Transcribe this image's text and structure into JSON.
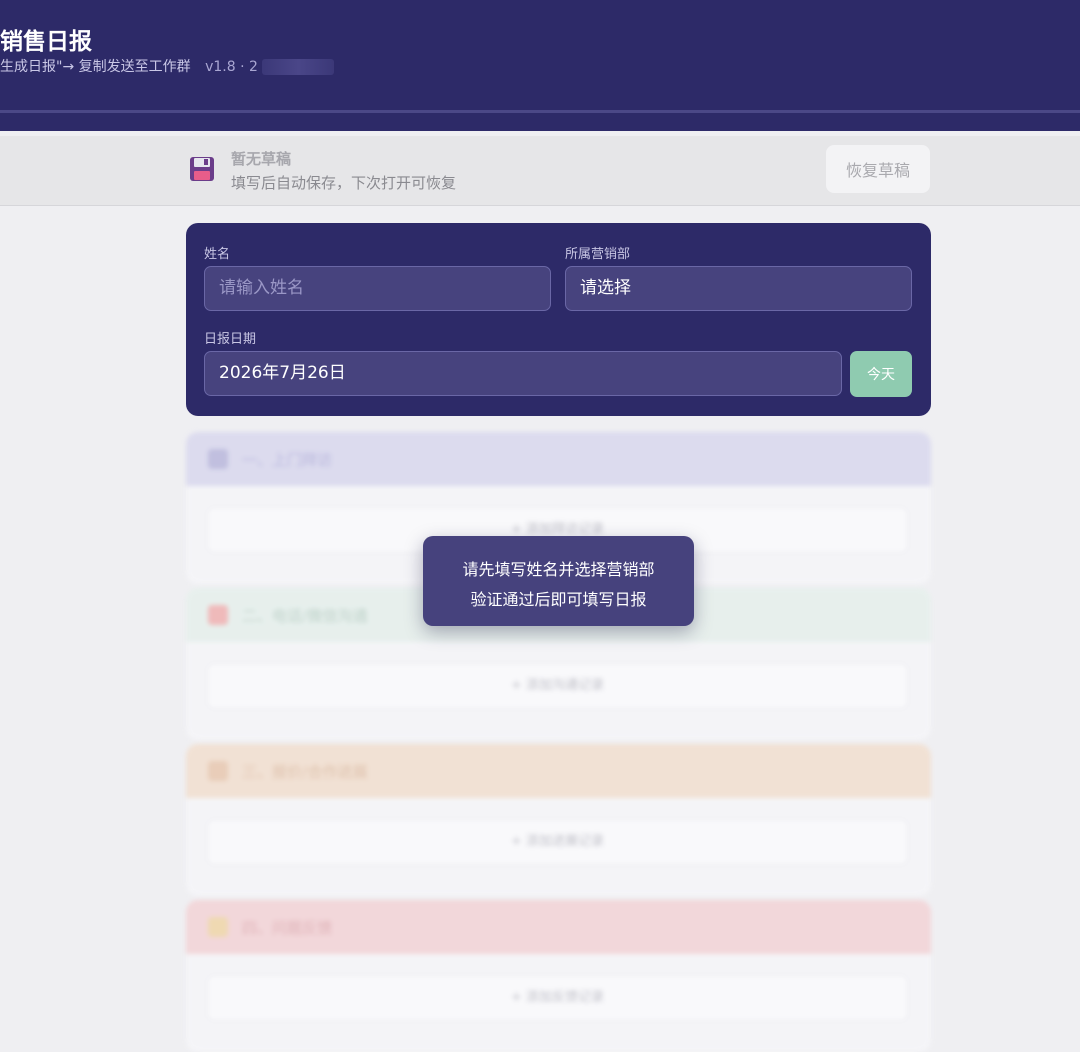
{
  "header": {
    "title": "销售日报",
    "subtitle": "生成日报\"→ 复制发送至工作群",
    "version": "v1.8 · 2"
  },
  "draft": {
    "title": "暂无草稿",
    "description": "填写后自动保存，下次打开可恢复",
    "restore_label": "恢复草稿",
    "icon": "floppy-disk-icon"
  },
  "form": {
    "name_label": "姓名",
    "name_placeholder": "请输入姓名",
    "dept_label": "所属营销部",
    "dept_value": "请选择",
    "date_label": "日报日期",
    "date_value": "2026年7月26日",
    "today_label": "今天"
  },
  "sections": [
    {
      "title": "一、上门拜访",
      "add_label": "+ 添加拜访记录",
      "color": "#d9d8ee"
    },
    {
      "title": "二、电话/微信沟通",
      "add_label": "+ 添加沟通记录",
      "color": "#e6f0ec"
    },
    {
      "title": "三、报价/合作进展",
      "add_label": "+ 添加进展记录",
      "color": "#f2dfcf"
    },
    {
      "title": "四、问题反馈",
      "add_label": "+ 添加反馈记录",
      "color": "#f3d3d6"
    }
  ],
  "lock_message": {
    "line1": "请先填写姓名并选择营销部",
    "line2": "验证通过后即可填写日报"
  },
  "colors": {
    "header_bg": "#2d2a68",
    "accent_green": "#8fcbb0",
    "toast_bg": "#46427d"
  }
}
